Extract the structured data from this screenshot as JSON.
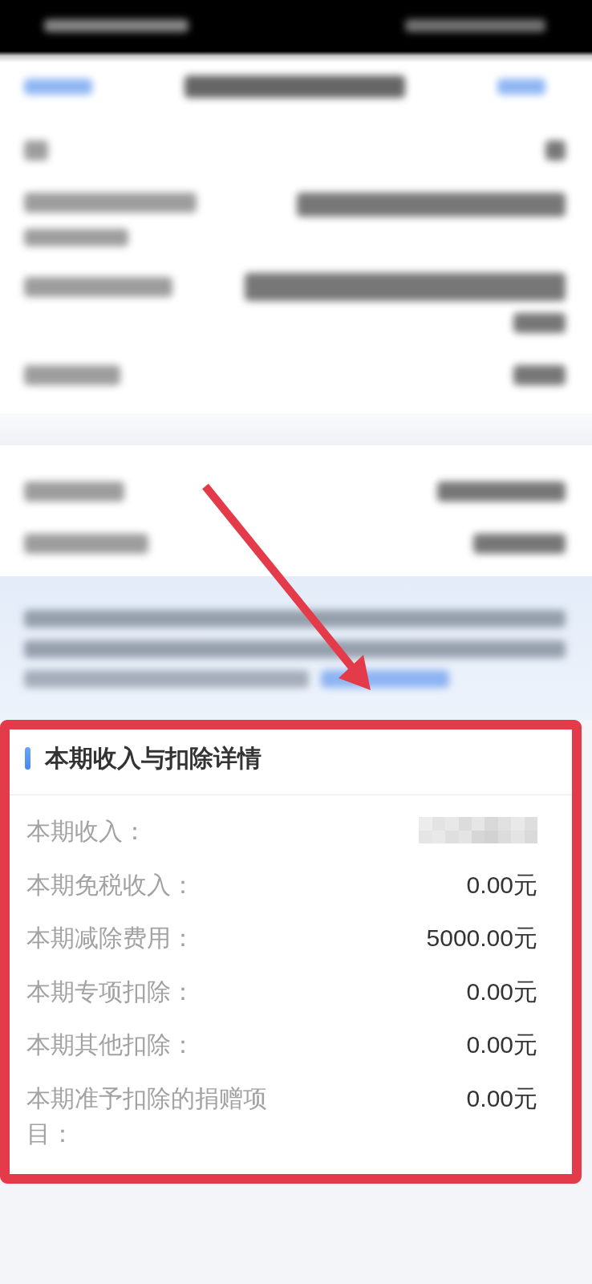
{
  "card": {
    "title": "本期收入与扣除详情",
    "rows": [
      {
        "label": "本期收入：",
        "redacted": true
      },
      {
        "label": "本期免税收入：",
        "value": "0.00元",
        "redacted": false
      },
      {
        "label": "本期减除费用：",
        "value": "5000.00元",
        "redacted": false
      },
      {
        "label": "本期专项扣除：",
        "value": "0.00元",
        "redacted": false
      },
      {
        "label": "本期其他扣除：",
        "value": "0.00元",
        "redacted": false
      },
      {
        "label": "本期准予扣除的捐赠项目：",
        "value": "0.00元",
        "redacted": false
      }
    ]
  },
  "annotations": {
    "frame": true,
    "arrow": true
  }
}
